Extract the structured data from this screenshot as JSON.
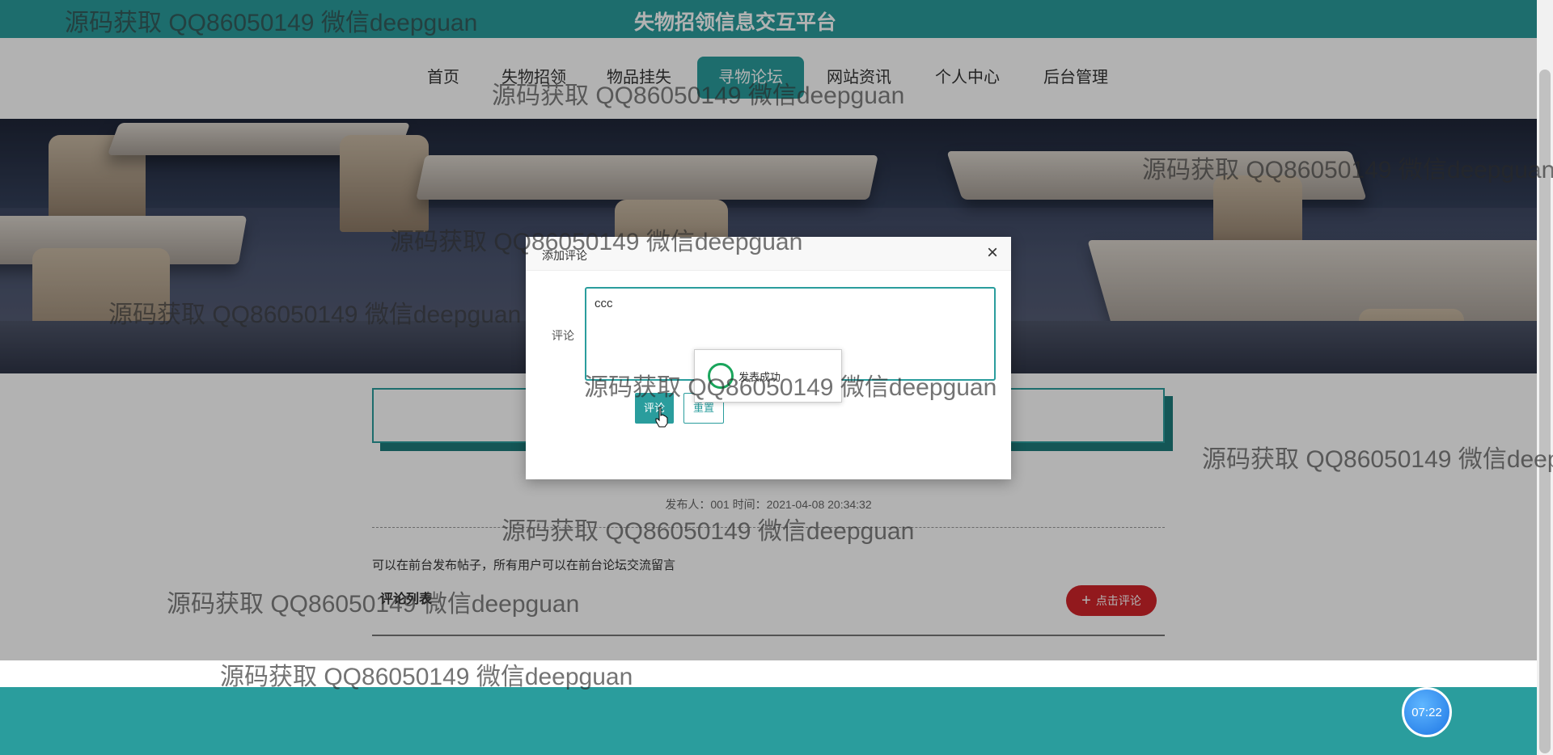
{
  "site": {
    "title": "失物招领信息交互平台"
  },
  "nav": {
    "items": [
      {
        "label": "首页",
        "active": false
      },
      {
        "label": "失物招领",
        "active": false
      },
      {
        "label": "物品挂失",
        "active": false
      },
      {
        "label": "寻物论坛",
        "active": true
      },
      {
        "label": "网站资讯",
        "active": false
      },
      {
        "label": "个人中心",
        "active": false
      },
      {
        "label": "后台管理",
        "active": false
      }
    ]
  },
  "post": {
    "meta": "发布人：001 时间：2021-04-08 20:34:32",
    "body": "可以在前台发布帖子，所有用户可以在前台论坛交流留言",
    "comments_heading": "评论列表",
    "comment_button": "点击评论"
  },
  "dialog": {
    "title": "添加评论",
    "field_label": "评论",
    "textarea_value": "ccc",
    "submit_label": "评论",
    "reset_label": "重置"
  },
  "toast": {
    "message": "发表成功"
  },
  "timer": {
    "value": "07:22"
  },
  "watermark": {
    "text": "源码获取 QQ86050149 微信deepguan"
  },
  "colors": {
    "primary": "#2a9d9d",
    "danger": "#d1242a",
    "success": "#1aa55c"
  }
}
